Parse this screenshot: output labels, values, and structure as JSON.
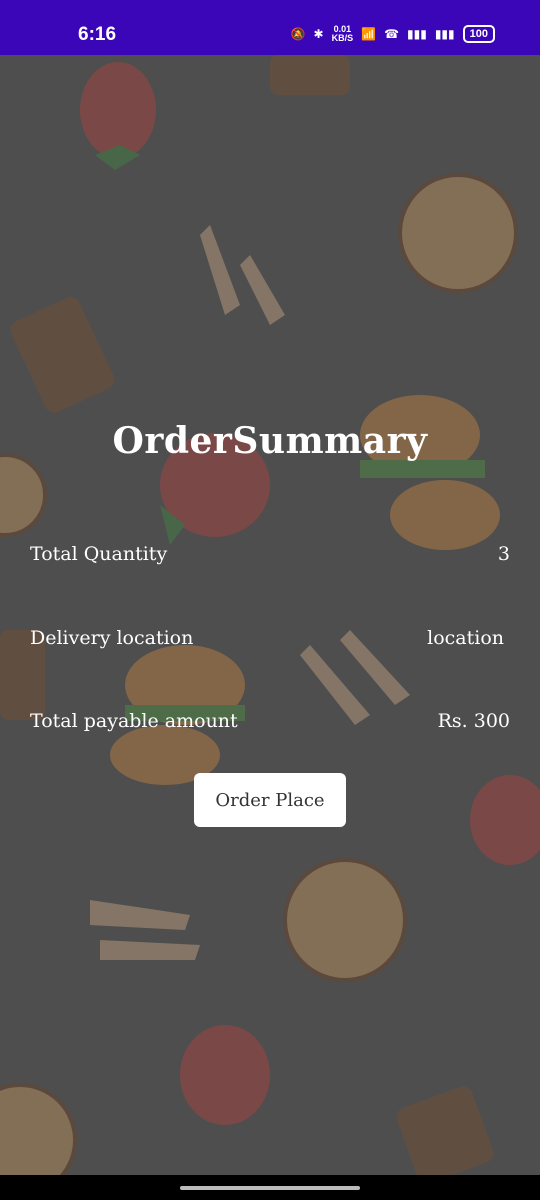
{
  "status_bar": {
    "time": "6:16",
    "speed_value": "0.01",
    "speed_unit": "KB/S",
    "battery": "100"
  },
  "screen": {
    "title": "OrderSummary",
    "rows": [
      {
        "label": "Total Quantity",
        "value": "3"
      },
      {
        "label": "Delivery location",
        "value": "location"
      },
      {
        "label": "Total payable amount",
        "value": "Rs. 300"
      }
    ],
    "order_button": "Order Place"
  },
  "colors": {
    "status_bar": "#3a06b8",
    "overlay": "#505050",
    "button": "#ffffff"
  },
  "icons": [
    "strawberry-icon",
    "burger-icon",
    "fork-knife-icon",
    "milkshake-icon",
    "cookie-icon"
  ]
}
